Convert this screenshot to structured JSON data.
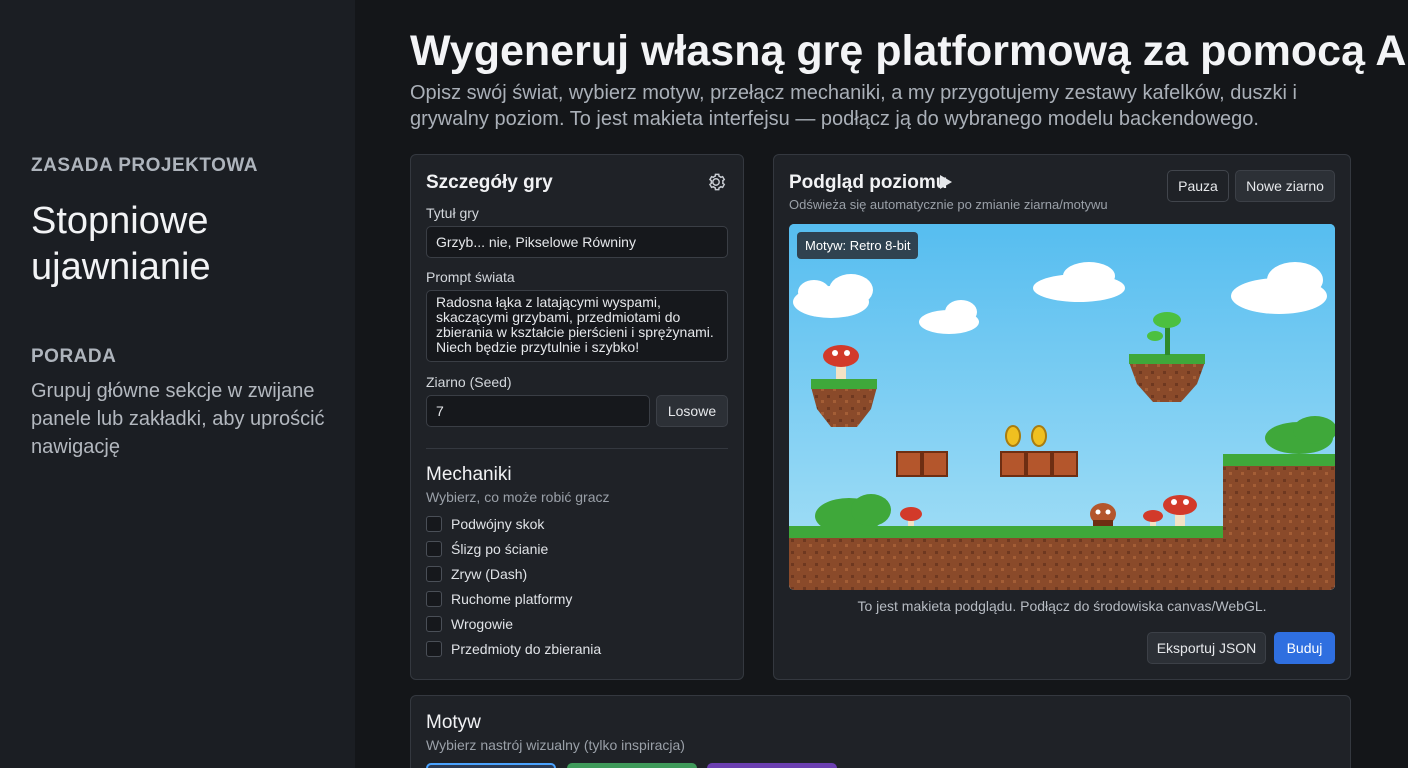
{
  "sidebar": {
    "section1_label": "ZASADA PROJEKTOWA",
    "section1_value": "Stopniowe ujawnianie",
    "section2_label": "PORADA",
    "section2_value": "Grupuj główne sekcje w zwijane panele lub zakładki, aby uprościć nawigację"
  },
  "header": {
    "title": "Wygeneruj własną grę platformową za pomocą AI",
    "subtitle": "Opisz swój świat, wybierz motyw, przełącz mechaniki, a my przygotujemy zestawy kafelków, duszki i grywalny poziom. To jest makieta interfejsu — podłącz ją do wybranego modelu backendowego."
  },
  "details": {
    "heading": "Szczegóły gry",
    "settings_icon": "gear-icon",
    "title_label": "Tytuł gry",
    "title_value": "Grzyb... nie, Pikselowe Równiny",
    "prompt_label": "Prompt świata",
    "prompt_value": "Radosna łąka z latającymi wyspami, skaczącymi grzybami, przedmiotami do zbierania w kształcie pierścieni i sprężynami. Niech będzie przytulnie i szybko!",
    "seed_label": "Ziarno (Seed)",
    "seed_value": "7",
    "random_button": "Losowe",
    "mechanics_heading": "Mechaniki",
    "mechanics_hint": "Wybierz, co może robić gracz",
    "mechanics": [
      {
        "label": "Podwójny skok",
        "checked": false
      },
      {
        "label": "Ślizg po ścianie",
        "checked": false
      },
      {
        "label": "Zryw (Dash)",
        "checked": false
      },
      {
        "label": "Ruchome platformy",
        "checked": false
      },
      {
        "label": "Wrogowie",
        "checked": false
      },
      {
        "label": "Przedmioty do zbierania",
        "checked": false
      }
    ]
  },
  "preview": {
    "heading": "Podgląd poziomu",
    "play_icon": "play-icon",
    "hint": "Odświeża się automatycznie po zmianie ziarna/motywu",
    "pause_button": "Pauza",
    "new_seed_button": "Nowe ziarno",
    "theme_badge": "Motyw: Retro 8-bit",
    "note": "To jest makieta podglądu. Podłącz do środowiska canvas/WebGL.",
    "export_button": "Eksportuj JSON",
    "build_button": "Buduj"
  },
  "motyw": {
    "heading": "Motyw",
    "hint": "Wybierz nastrój wizualny (tylko inspiracja)"
  },
  "colors": {
    "accent": "#2f6fe0",
    "sky": "#5fc3ee",
    "grass": "#3fa83a",
    "dirt": "#8a4a2a"
  }
}
